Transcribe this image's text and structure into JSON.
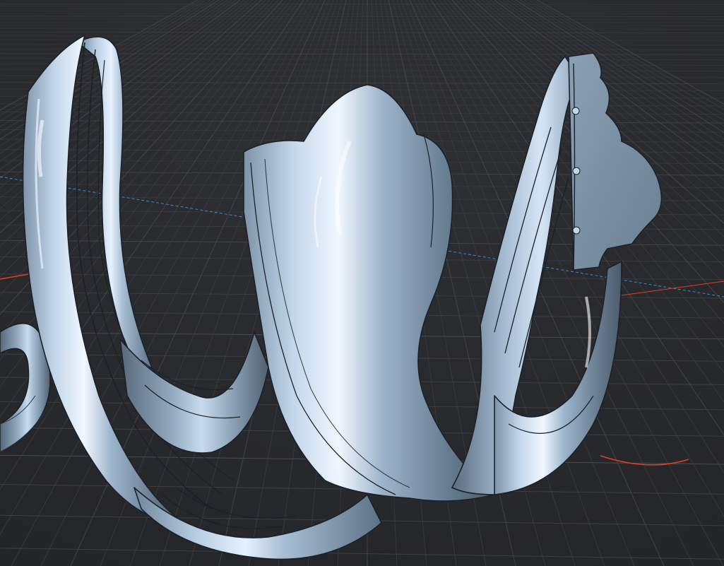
{
  "viewport": {
    "background_color": "#2a2b2e",
    "grid_minor_color": "#3c3e42",
    "grid_major_color": "#4a4c51",
    "axis_x_color": "#e2401f",
    "axis_y_color": "#2f8fd0"
  },
  "model": {
    "type": "helical swept molding profile",
    "surface_color": "#9fb6cc",
    "highlight_color": "#eaf3ff",
    "shadow_color": "#3f4e5d",
    "edge_color": "#1b2128",
    "cap_color": "#7e93a6"
  }
}
